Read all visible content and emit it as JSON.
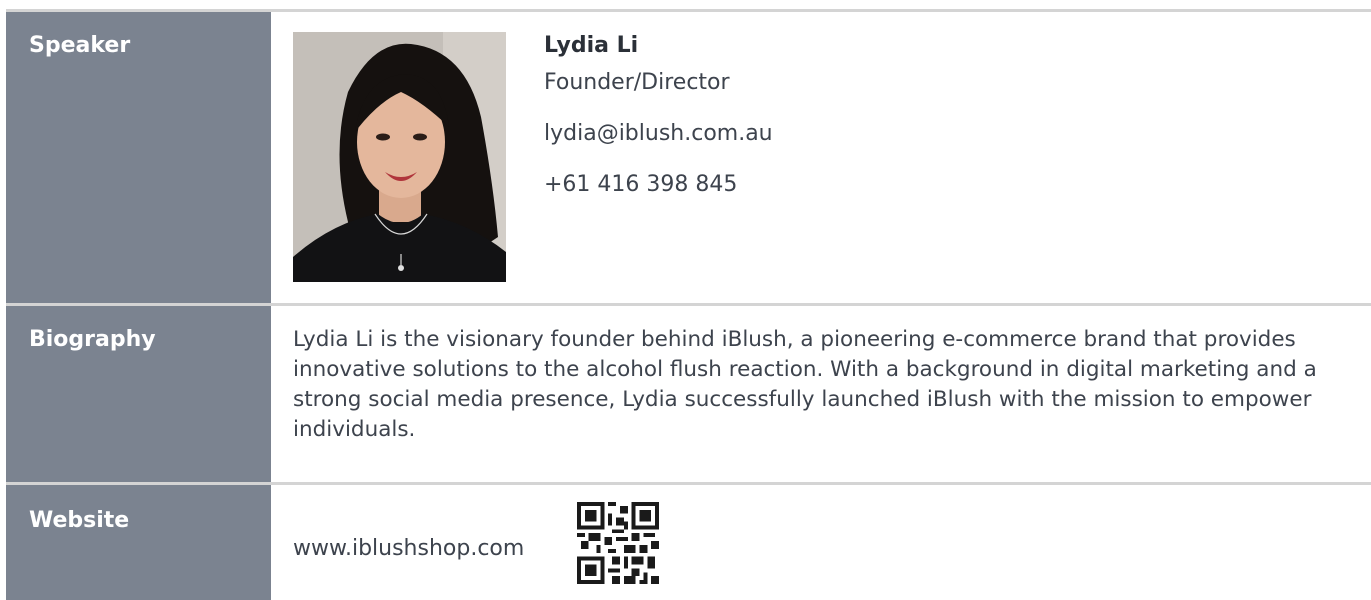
{
  "speaker": {
    "label": "Speaker",
    "name": "Lydia Li",
    "title": "Founder/Director",
    "email": "lydia@iblush.com.au",
    "phone": "+61 416 398 845"
  },
  "biography": {
    "label": "Biography",
    "text": "Lydia Li is the visionary founder behind iBlush, a pioneering e-commerce brand that provides innovative solutions to the alcohol flush reaction. With a background in digital marketing and a strong social media presence, Lydia successfully launched iBlush with the mission to empower individuals."
  },
  "website": {
    "label": "Website",
    "url": "www.iblushshop.com"
  },
  "colors": {
    "label_bg": "#7b8390",
    "rule": "#d4d4d4",
    "text": "#3d434d"
  }
}
